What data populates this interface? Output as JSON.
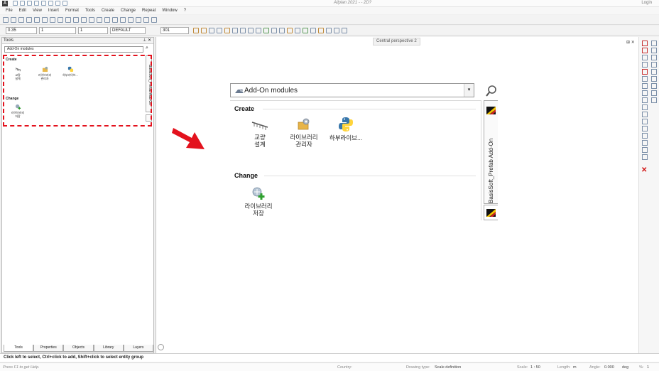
{
  "window": {
    "title": "Allplan 2021 - - 2D?",
    "login": "Login"
  },
  "menu": [
    "File",
    "Edit",
    "View",
    "Insert",
    "Format",
    "Tools",
    "Create",
    "Change",
    "Repeat",
    "Window",
    "?"
  ],
  "toolbar": {
    "pen_value": "0.35",
    "line_value": "1",
    "color_value": "1",
    "layer_value": "DEFAULT",
    "scale_value": "301"
  },
  "tools_panel": {
    "title": "Tools",
    "selected_module": "Add-On modules",
    "create_heading": "Create",
    "change_heading": "Change",
    "create_items": [
      "교량\n설계",
      "라이브러리\n관리자",
      "하부라이브..."
    ],
    "change_items": [
      "라이브러리\n저장"
    ],
    "side_tab": "BasisSoft_Prefab Add-On",
    "tabs": [
      "Tools",
      "Properties",
      "Objects",
      "Library",
      "Layers"
    ]
  },
  "zoom": {
    "selected_module": "Add-On modules",
    "create_heading": "Create",
    "change_heading": "Change",
    "create_items": [
      {
        "line1": "교량",
        "line2": "설계",
        "icon": "bridge-icon"
      },
      {
        "line1": "라이브러리",
        "line2": "관리자",
        "icon": "library-manager-icon"
      },
      {
        "line1": "하부라이브...",
        "line2": "",
        "icon": "python-icon"
      }
    ],
    "change_items": [
      {
        "line1": "라이브러리",
        "line2": "저장",
        "icon": "library-save-icon"
      }
    ],
    "side_tab": "BasisSoft_Prefab Add-On"
  },
  "viewport": {
    "label": "Central perspective 2"
  },
  "status": {
    "hint": "Click left to select, Ctrl+click to add, Shift+click to select entity group",
    "help": "Press F1 to get Help.",
    "country_label": "Country:",
    "drawing_type_label": "Drawing type:",
    "drawing_type": "Scale definition",
    "scale_label": "Scale:",
    "scale": "1 : 50",
    "length_label": "Length:",
    "length": "m",
    "angle_label": "Angle:",
    "angle": "0.000",
    "angle_unit": "deg",
    "percent_label": "%:",
    "percent": "1"
  },
  "colors": {
    "highlight": "#e3121d",
    "arrow": "#e3121d"
  }
}
